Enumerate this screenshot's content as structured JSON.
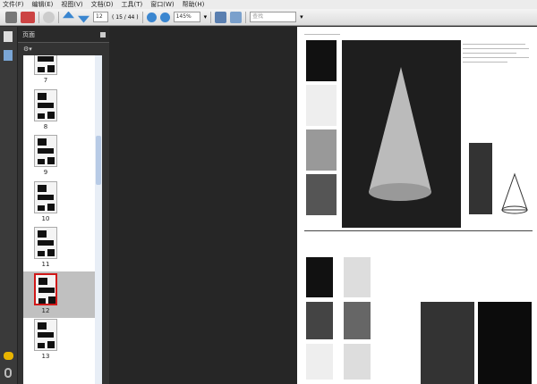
{
  "menu": [
    "文件(F)",
    "编辑(E)",
    "视图(V)",
    "文档(D)",
    "工具(T)",
    "窗口(W)",
    "帮助(H)"
  ],
  "toolbar": {
    "page_number": "12",
    "page_count": "( 15 / 44 )",
    "zoom": "145%",
    "search_placeholder": "查找"
  },
  "panel": {
    "title": "页面"
  },
  "thumbnails": [
    {
      "label": "7"
    },
    {
      "label": "8"
    },
    {
      "label": "9"
    },
    {
      "label": "10"
    },
    {
      "label": "11"
    },
    {
      "label": "12",
      "selected": true
    },
    {
      "label": "13"
    }
  ],
  "colors": {
    "selected_border": "#d01818",
    "selected_bg": "#c0c0c0"
  }
}
